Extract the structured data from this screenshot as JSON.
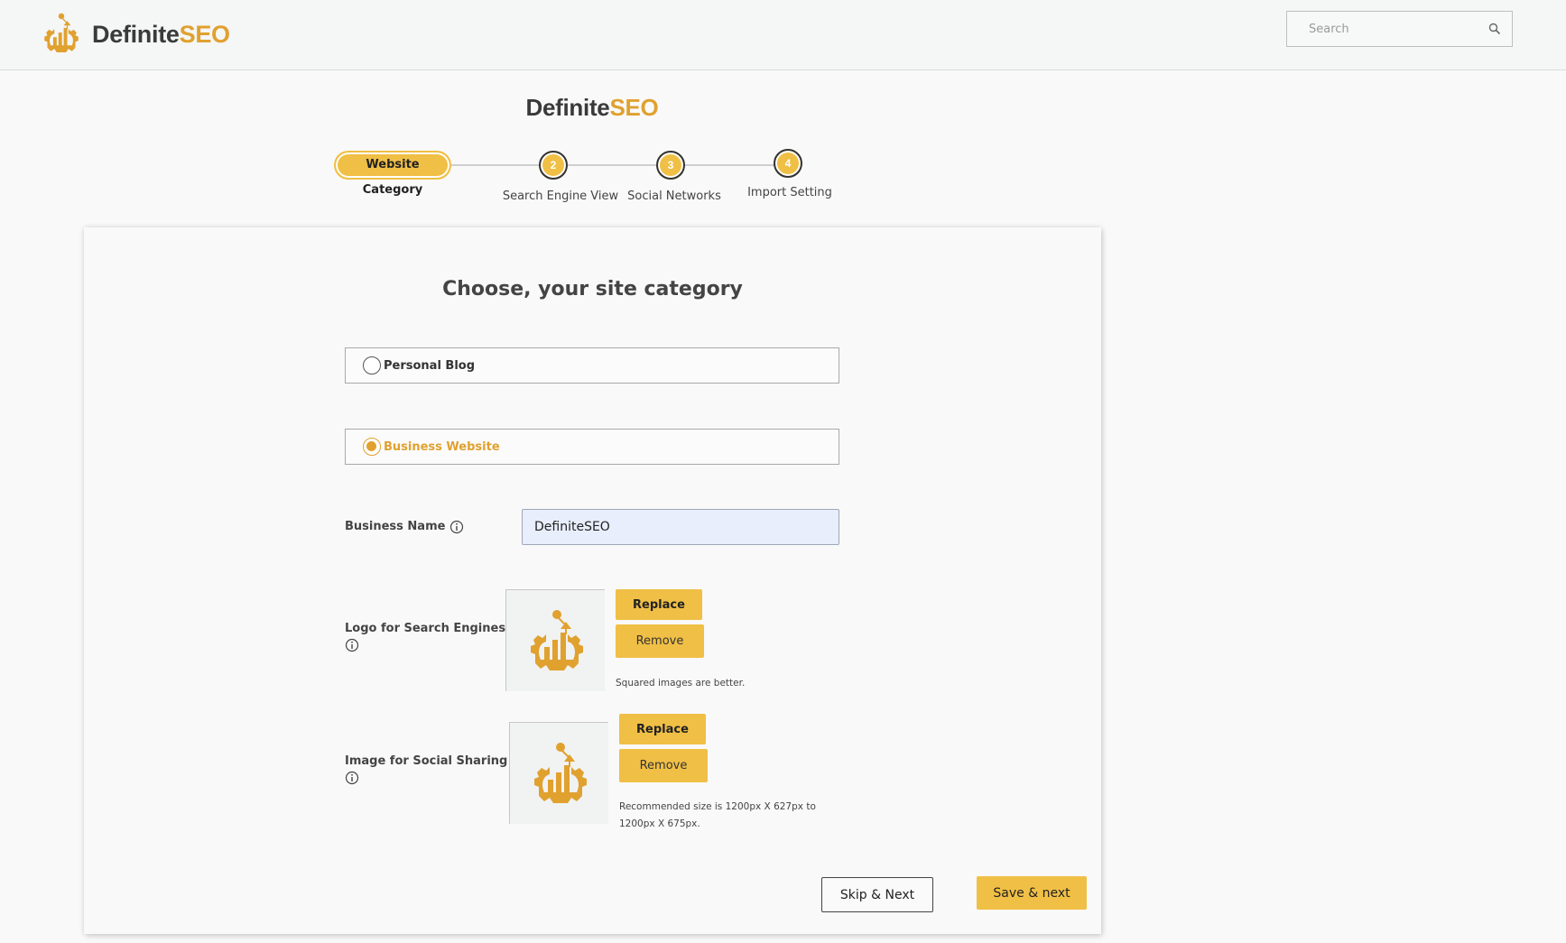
{
  "header": {
    "brand_part1": "Definite",
    "brand_part2": "SEO",
    "search_placeholder": "Search",
    "search_icon": "search-icon"
  },
  "wizard": {
    "title_part1": "Definite",
    "title_part2": "SEO",
    "steps": [
      {
        "number": "1",
        "label": "Website Category",
        "active": true
      },
      {
        "number": "2",
        "label": "Search Engine View",
        "active": false
      },
      {
        "number": "3",
        "label": "Social Networks",
        "active": false
      },
      {
        "number": "4",
        "label": "Import Setting",
        "active": false
      }
    ]
  },
  "form": {
    "heading": "Choose, your site category",
    "options": [
      {
        "label": "Personal Blog",
        "selected": false
      },
      {
        "label": "Business Website",
        "selected": true
      }
    ],
    "business_name": {
      "label": "Business Name",
      "value": "DefiniteSEO"
    },
    "logo": {
      "label": "Logo for Search Engines",
      "replace_label": "Replace",
      "remove_label": "Remove",
      "hint": "Squared images are better."
    },
    "social_image": {
      "label": "Image for Social Sharing",
      "replace_label": "Replace",
      "remove_label": "Remove",
      "hint": "Recommended size is 1200px X 627px to 1200px X 675px."
    },
    "skip_label": "Skip & Next",
    "save_label": "Save & next"
  },
  "colors": {
    "accent": "#f0bf45",
    "brand_orange": "#e0a12f",
    "input_bg": "#e8eefb"
  }
}
